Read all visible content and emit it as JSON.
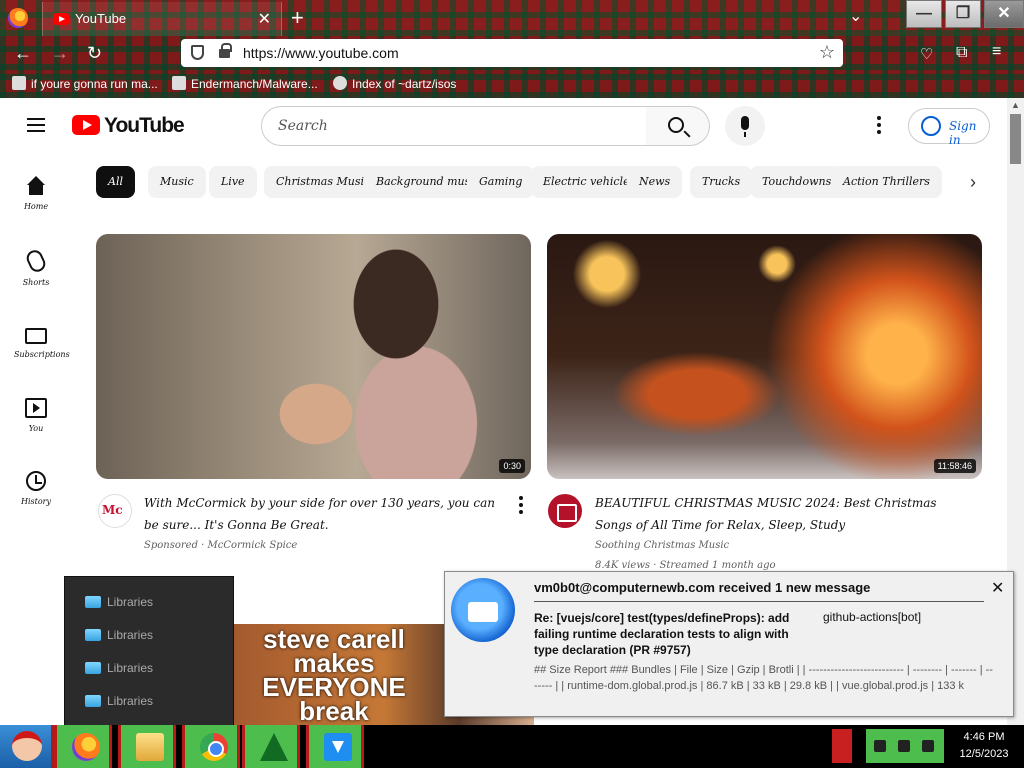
{
  "browser": {
    "tab_title": "YouTube",
    "url": "https://www.youtube.com",
    "bookmarks": [
      {
        "label": "if youre gonna run ma..."
      },
      {
        "label": "Endermanch/Malware..."
      },
      {
        "label": "Index of ~dartz/isos"
      }
    ]
  },
  "youtube": {
    "logo_text": "YouTube",
    "search_placeholder": "Search",
    "sign_in_label": "Sign in",
    "chips": [
      "All",
      "Music",
      "Live",
      "Christmas Music",
      "Background music",
      "Gaming",
      "Electric vehicles",
      "News",
      "Trucks",
      "Touchdowns",
      "Action Thrillers"
    ],
    "rail": [
      {
        "label": "Home",
        "icon": "home-icon"
      },
      {
        "label": "Shorts",
        "icon": "shorts-icon"
      },
      {
        "label": "Subscriptions",
        "icon": "subscriptions-icon"
      },
      {
        "label": "You",
        "icon": "library-icon"
      },
      {
        "label": "History",
        "icon": "history-icon"
      }
    ],
    "videos": [
      {
        "title": "With McCormick by your side for over 130 years, you can be sure... It's Gonna Be Great.",
        "channel_line": "Sponsored · McCormick Spice",
        "duration": "0:30"
      },
      {
        "title": "BEAUTIFUL CHRISTMAS MUSIC 2024: Best Christmas Songs of All Time for Relax, Sleep, Study",
        "channel_line": "Soothing Christmas Music",
        "views_line": "8.4K views · Streamed 1 month ago",
        "duration": "11:58:46"
      }
    ],
    "thumb3_text": "steve carell makes EVERYONE break"
  },
  "explorer": {
    "items": [
      "Libraries",
      "Libraries",
      "Libraries",
      "Libraries"
    ]
  },
  "notification": {
    "header": "vm0b0t@computernewb.com received 1 new message",
    "subject": "Re: [vuejs/core] test(types/defineProps): add failing runtime declaration tests to align with type declaration (PR #9757)",
    "sender": "github-actions[bot]",
    "body": "## Size Report ### Bundles | File | Size | Gzip | Brotli | | -------------------------- | -------- | ------- | ------- | | runtime-dom.global.prod.js | 86.7 kB | 33 kB | 29.8 kB | | vue.global.prod.js | 133 k"
  },
  "taskbar": {
    "apps": [
      "firefox-icon",
      "file-explorer-icon",
      "chrome-icon",
      "christmas-tree-icon",
      "download-icon"
    ],
    "time": "4:46 PM",
    "date": "12/5/2023"
  },
  "colors": {
    "youtube_red": "#ff0000",
    "link_blue": "#065fd4",
    "taskbar_green": "#4dbd4d",
    "plaid_red": "#8a1d1d"
  }
}
